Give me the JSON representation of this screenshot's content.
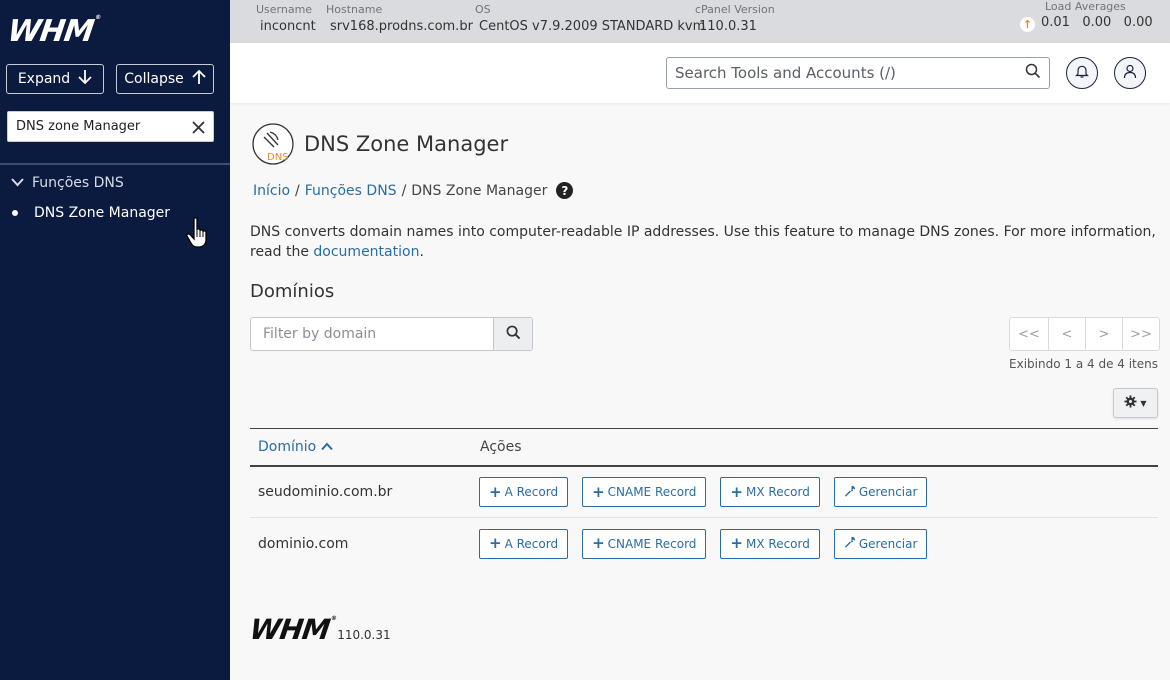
{
  "sidebar": {
    "logo": "WHM",
    "expand_label": "Expand",
    "collapse_label": "Collapse",
    "search_value": "DNS zone Manager",
    "group_label": "Funções DNS",
    "item_label": "DNS Zone Manager"
  },
  "infobar": {
    "username_label": "Username",
    "username": "inconcnt",
    "hostname_label": "Hostname",
    "hostname": "srv168.prodns.com.br",
    "os_label": "OS",
    "os": "CentOS v7.9.2009 STANDARD kvm",
    "cpanel_label": "cPanel Version",
    "cpanel": "110.0.31",
    "load_label": "Load Averages",
    "load_values": "0.01   0.00   0.00"
  },
  "header": {
    "search_placeholder": "Search Tools and Accounts (/)"
  },
  "page": {
    "icon_text": "DNS",
    "title": "DNS Zone Manager",
    "breadcrumb": [
      "Início",
      "Funções DNS",
      "DNS Zone Manager"
    ],
    "description": "DNS converts domain names into computer-readable IP addresses. Use this feature to manage DNS zones. For more information, read the",
    "doc_link": "documentation",
    "period": ".",
    "section_title": "Domínios",
    "filter_placeholder": "Filter by domain",
    "pager": [
      "<<",
      "<",
      ">",
      ">>"
    ],
    "showing": "Exibindo 1 a 4 de 4 itens"
  },
  "table": {
    "col_domain": "Domínio",
    "col_actions": "Ações",
    "rows": [
      {
        "domain": "seudominio.com.br"
      },
      {
        "domain": "dominio.com"
      }
    ],
    "actions": [
      "A Record",
      "CNAME Record",
      "MX Record",
      "Gerenciar"
    ]
  },
  "footer": {
    "logo": "WHM",
    "version": "110.0.31"
  },
  "colors": {
    "sidebar_bg": "#0b1a3f",
    "link": "#2b6ca3",
    "accent_orange": "#e58b2f"
  }
}
